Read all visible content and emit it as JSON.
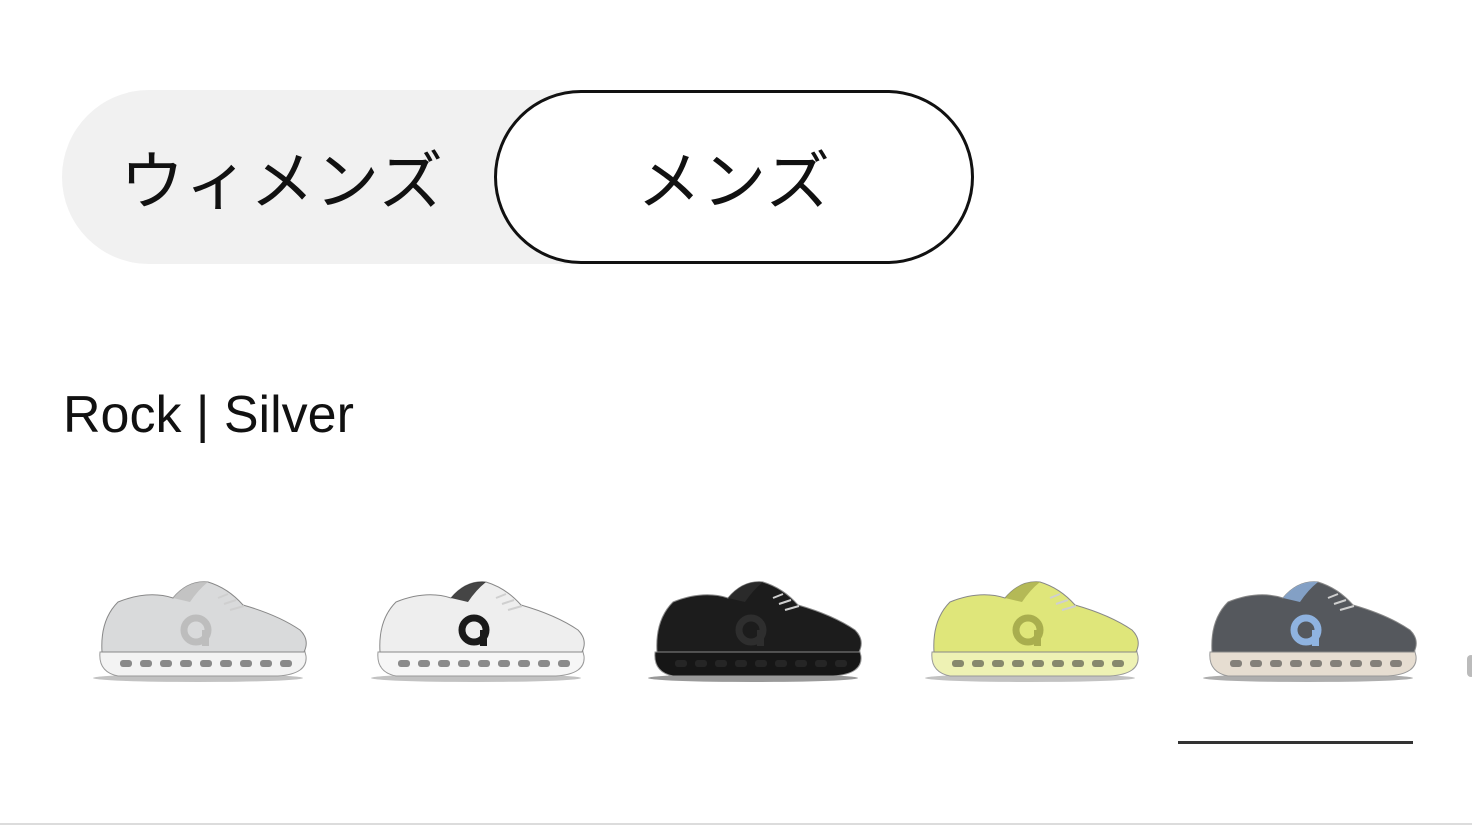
{
  "gender_toggle": {
    "women_label": "ウィメンズ",
    "men_label": "メンズ",
    "selected": "men"
  },
  "selected_color": "Rock | Silver",
  "swatches": [
    {
      "upper": "#d9dadb",
      "accent": "#bdbdbd",
      "sole": "#f3f3f3",
      "shadow": "#9a9a9a"
    },
    {
      "upper": "#eeeeee",
      "accent": "#1a1a1a",
      "sole": "#f6f6f6",
      "shadow": "#9a9a9a"
    },
    {
      "upper": "#1c1c1c",
      "accent": "#2e2e2e",
      "sole": "#161616",
      "shadow": "#555555"
    },
    {
      "upper": "#dfe67a",
      "accent": "#a9ae4e",
      "sole": "#eef2b4",
      "shadow": "#999999"
    },
    {
      "upper": "#55585d",
      "accent": "#8fb3e0",
      "sole": "#e6ddd1",
      "shadow": "#777777"
    }
  ],
  "selected_swatch_index": 4
}
